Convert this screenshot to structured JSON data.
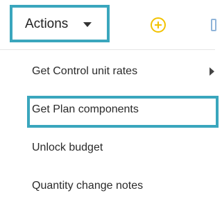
{
  "toolbar": {
    "actions_label": "Actions",
    "caret_icon": "caret-down-icon",
    "add_icon": "plus-circle-icon",
    "partial_icon": "panel-icon"
  },
  "menu": {
    "items": [
      {
        "label": "Get Control unit rates",
        "has_submenu": true
      },
      {
        "label": "Get Plan components",
        "highlighted": true
      },
      {
        "label": "Unlock budget"
      },
      {
        "label": "Quantity change notes"
      }
    ]
  },
  "colors": {
    "highlight_border": "#3aa6bd",
    "add_icon": "#f2c200",
    "text": "#2a2a2a"
  }
}
